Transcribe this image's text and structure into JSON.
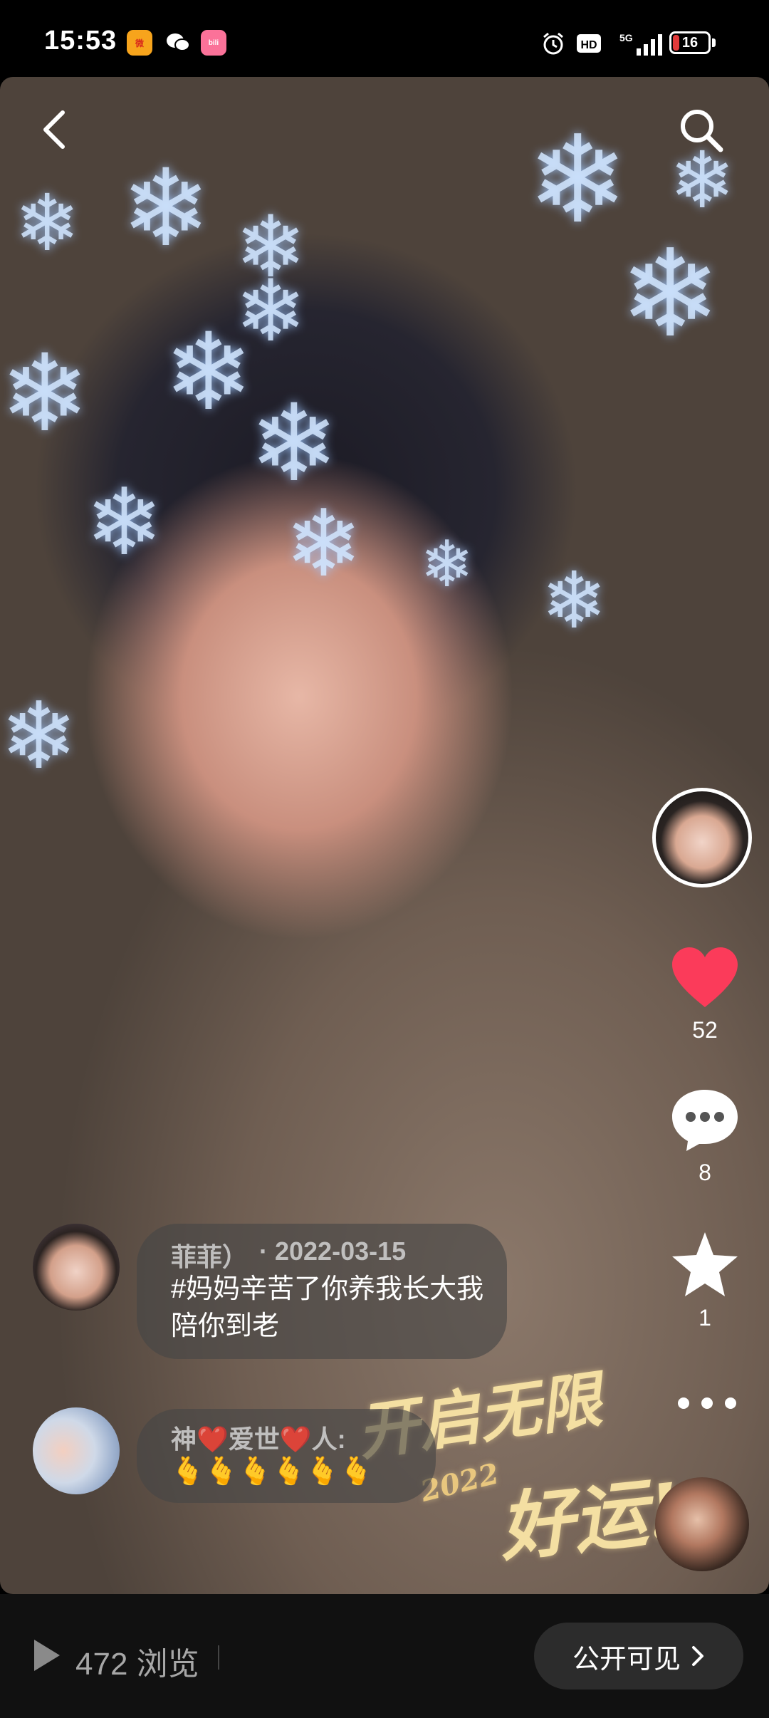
{
  "status_bar": {
    "time": "15:53",
    "battery_level": "16",
    "network": "5G",
    "hd_label": "HD",
    "apps": [
      "weibo-icon",
      "wechat-icon",
      "bilibili-icon"
    ]
  },
  "header": {
    "back_icon": "back-icon",
    "search_icon": "search-icon"
  },
  "rail": {
    "like_count": "52",
    "comment_count": "8",
    "favorite_count": "1",
    "like_color": "#fb3b5a"
  },
  "comments": [
    {
      "user": "菲菲）",
      "date": "· 2022-03-15",
      "text": "#妈妈辛苦了你养我长大我陪你到老"
    },
    {
      "user": "神❤️爱世❤️人:",
      "text": "🫰🫰🫰🫰🫰🫰"
    }
  ],
  "overlay": {
    "line1": "开启无限",
    "line2": "好运!",
    "year": "2022"
  },
  "bottom_bar": {
    "views": "472 浏览",
    "visibility": "公开可见"
  }
}
